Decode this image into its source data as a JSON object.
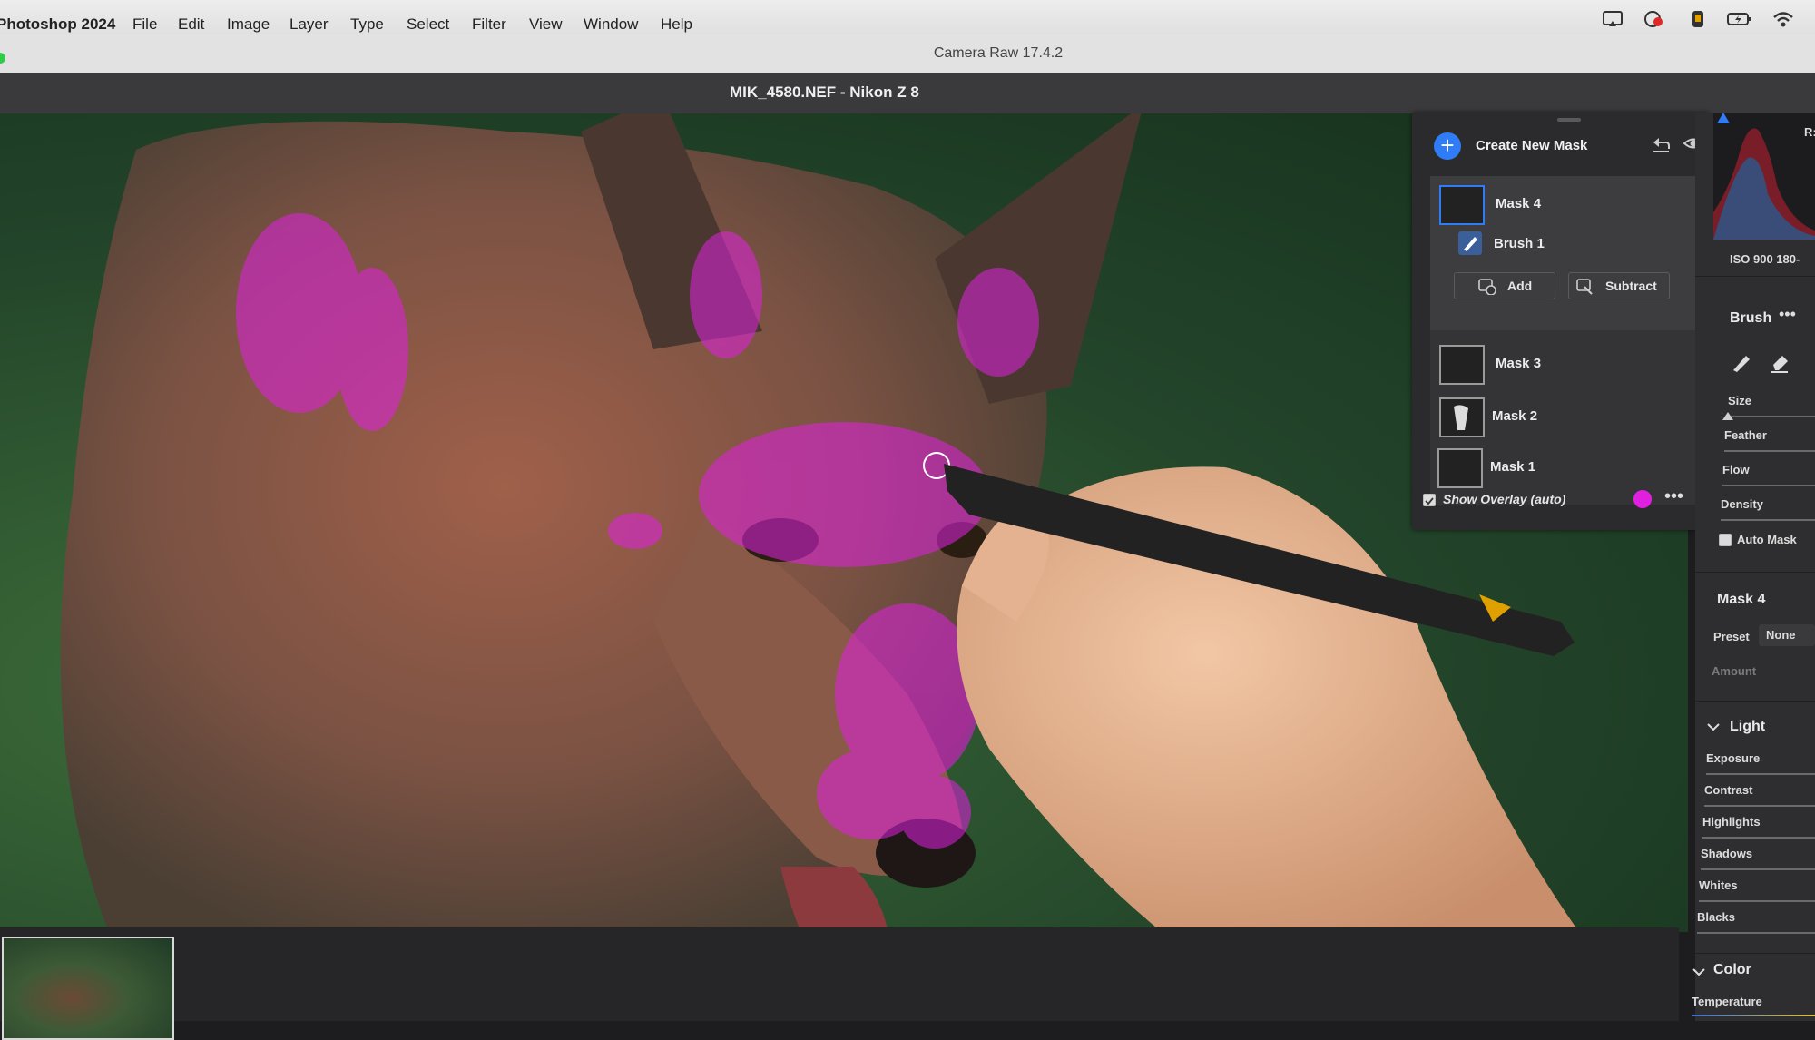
{
  "menubar": {
    "app_name": "Photoshop 2024",
    "menus": [
      "File",
      "Edit",
      "Image",
      "Layer",
      "Type",
      "Select",
      "Filter",
      "View",
      "Window",
      "Help"
    ]
  },
  "window": {
    "title": "Camera Raw 17.4.2"
  },
  "file": {
    "header": "MIK_4580.NEF  -  Nikon Z 8"
  },
  "mask_panel": {
    "create_label": "Create New Mask",
    "masks": [
      {
        "label": "Mask 4",
        "selected": true
      },
      {
        "label": "Mask 3"
      },
      {
        "label": "Mask 2"
      },
      {
        "label": "Mask 1"
      }
    ],
    "component_label": "Brush 1",
    "add_label": "Add",
    "subtract_label": "Subtract",
    "overlay_label": "Show Overlay (auto)",
    "overlay_checked": true,
    "overlay_color": "#e020e0"
  },
  "right_panel": {
    "iso_text": "ISO 900   180-",
    "r_label": "R:",
    "brush_title": "Brush",
    "brush_params": [
      "Size",
      "Feather",
      "Flow",
      "Density"
    ],
    "auto_mask_label": "Auto Mask",
    "mask_title": "Mask 4",
    "preset_label": "Preset",
    "preset_value": "None",
    "amount_label": "Amount",
    "light_title": "Light",
    "light_params": [
      "Exposure",
      "Contrast",
      "Highlights",
      "Shadows",
      "Whites",
      "Blacks"
    ],
    "color_title": "Color",
    "temperature_label": "Temperature"
  },
  "colors": {
    "accent": "#2f7cf6",
    "overlay": "#e020e0",
    "panel": "#2b2b2d"
  }
}
